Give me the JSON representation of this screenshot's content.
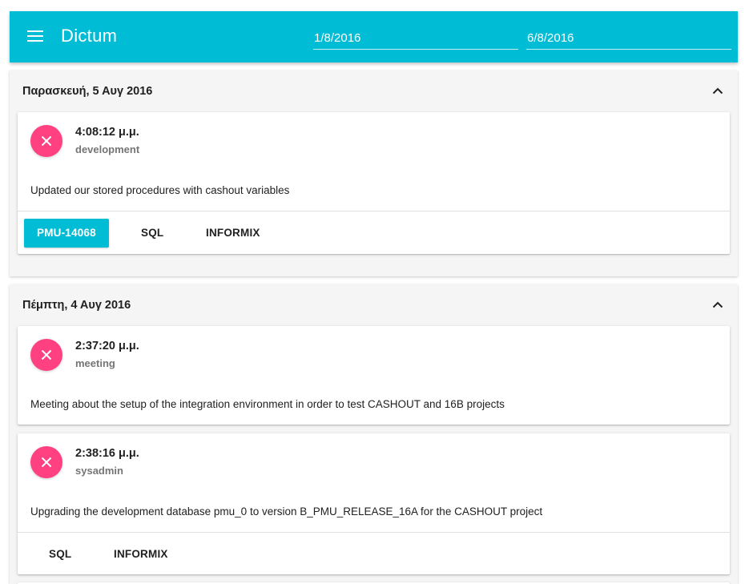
{
  "app": {
    "title": "Dictum",
    "date_from": "1/8/2016",
    "date_to": "6/8/2016"
  },
  "days": [
    {
      "title": "Παρασκευή, 5 Αυγ 2016",
      "entries": [
        {
          "time": "4:08:12 μ.μ.",
          "category": "development",
          "description": "Updated our stored procedures with cashout variables",
          "tags": [
            "PMU-14068",
            "SQL",
            "INFORMIX"
          ]
        }
      ]
    },
    {
      "title": "Πέμπτη, 4 Αυγ 2016",
      "entries": [
        {
          "time": "2:37:20 μ.μ.",
          "category": "meeting",
          "description": "Meeting about the setup of the integration environment in order to test CASHOUT and 16B projects",
          "tags": []
        },
        {
          "time": "2:38:16 μ.μ.",
          "category": "sysadmin",
          "description": "Upgrading the development database pmu_0 to version B_PMU_RELEASE_16A for the CASHOUT project",
          "tags": [
            "SQL",
            "INFORMIX"
          ]
        }
      ]
    }
  ],
  "colors": {
    "primary": "#00bcd4",
    "accent": "#ff4081",
    "group_background": "#f5f5f5"
  },
  "icons": {
    "menu": "menu-icon",
    "collapse": "chevron-up-icon",
    "delete": "close-icon"
  }
}
